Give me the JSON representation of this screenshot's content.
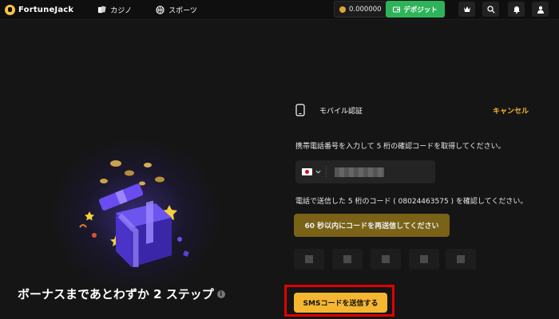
{
  "header": {
    "logo_text": "FortuneJack",
    "nav": [
      {
        "label": "カジノ",
        "icon": "cards-icon"
      },
      {
        "label": "スポーツ",
        "icon": "basketball-icon"
      }
    ],
    "balance": "0.000000",
    "deposit_label": "デポジット",
    "right_icons": [
      "crown-icon",
      "search-icon",
      "bell-icon",
      "user-icon"
    ]
  },
  "promo": {
    "title": "ボーナスまであとわずか 2 ステップ"
  },
  "form": {
    "title": "モバイル認証",
    "cancel": "キャンセル",
    "instruction": "携帯電話番号を入力して 5 桁の確認コードを取得してください。",
    "country_flag": "JP",
    "sent_text": "電話で送信した 5 桁のコード ( 08024463575 ) を確認してください。",
    "resend_label": "60 秒以内にコードを再送信してください",
    "code_digits": 5,
    "submit_label": "SMSコードを送信する"
  },
  "colors": {
    "accent": "#f5b731",
    "deposit": "#2fb35a",
    "highlight": "#e00000"
  }
}
